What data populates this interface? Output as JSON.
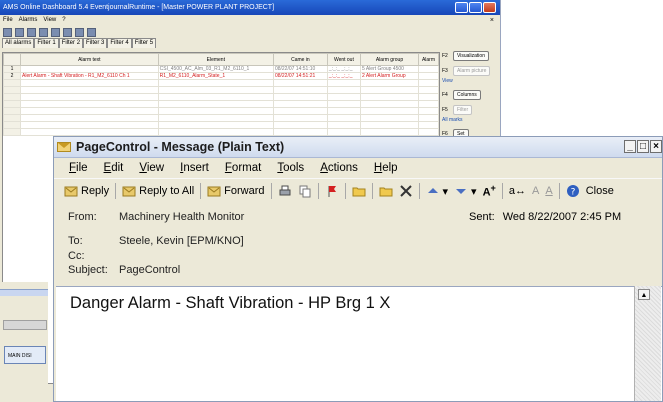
{
  "background_app": {
    "title": "AMS Online Dashboard 5.4   EventjournalRuntime - [Master POWER PLANT PROJECT]",
    "menu": [
      "File",
      "Alarms",
      "View",
      "?"
    ],
    "close_glyph": "×",
    "tabs": [
      "All alarms",
      "Filter 1",
      "Filter 2",
      "Filter 3",
      "Filter 4",
      "Filter 5"
    ],
    "columns": [
      "Alarm text",
      "Element",
      "Came in",
      "Went out",
      "Alarm group",
      "Alarm"
    ],
    "rows": [
      {
        "num": "1",
        "alarm_text": "",
        "element": "CSI_4500_AC_Alm_03_R1_M2_6110_1",
        "came_in": "08/22/07 14:51:10",
        "went_out": "_:_:_ _:_:_",
        "alarm_group": "5 Alert Group 4500",
        "style": "gray"
      },
      {
        "num": "2",
        "alarm_text": "Alert Alarm - Shaft Vibration - R1_M2_6110 Ch 1",
        "element": "R1_M2_6110_Alarm_State_1",
        "came_in": "08/22/07 14:51:21",
        "went_out": "_:_:_ _:_:_",
        "alarm_group": "2 Alert Alarm Group",
        "style": "red"
      }
    ],
    "right_panel": {
      "f2_key": "F2",
      "f2_label": "Visualization",
      "f3_key": "F3",
      "f3_label": "Alarm picture",
      "view_link": "View",
      "f4_key": "F4",
      "f4_label": "Columns",
      "f5_key": "F5",
      "f5_label": "Filter",
      "marks_link": "All marks",
      "f6_key": "F6",
      "f6_label": "Set"
    },
    "main_display_label": "MAIN DISI"
  },
  "message_window": {
    "title": "PageControl - Message (Plain Text)",
    "window_buttons": [
      "_",
      "□",
      "×"
    ],
    "menu": [
      {
        "label": "File",
        "u": "F",
        "rest": "ile"
      },
      {
        "label": "Edit",
        "u": "E",
        "rest": "dit"
      },
      {
        "label": "View",
        "u": "V",
        "rest": "iew"
      },
      {
        "label": "Insert",
        "u": "I",
        "rest": "nsert"
      },
      {
        "label": "Format",
        "u": "F",
        "rest": "ormat"
      },
      {
        "label": "Tools",
        "u": "T",
        "rest": "ools"
      },
      {
        "label": "Actions",
        "u": "A",
        "rest": "ctions"
      },
      {
        "label": "Help",
        "u": "H",
        "rest": "elp"
      }
    ],
    "toolbar": {
      "reply": "Reply",
      "reply_all": "Reply to All",
      "forward": "Forward",
      "close": "Close"
    },
    "header": {
      "from_label": "From:",
      "from_value": "Machinery Health Monitor",
      "sent_label": "Sent:",
      "sent_value": "Wed 8/22/2007 2:45 PM",
      "to_label": "To:",
      "to_value": "Steele, Kevin [EPM/KNO]",
      "cc_label": "Cc:",
      "cc_value": "",
      "subject_label": "Subject:",
      "subject_value": "PageControl"
    },
    "body": "Danger Alarm - Shaft Vibration -  HP Brg 1 X"
  },
  "colors": {
    "alarm_red": "#d42020",
    "title_blue": "#1747b8",
    "envelope_yellow": "#f1d37a"
  }
}
